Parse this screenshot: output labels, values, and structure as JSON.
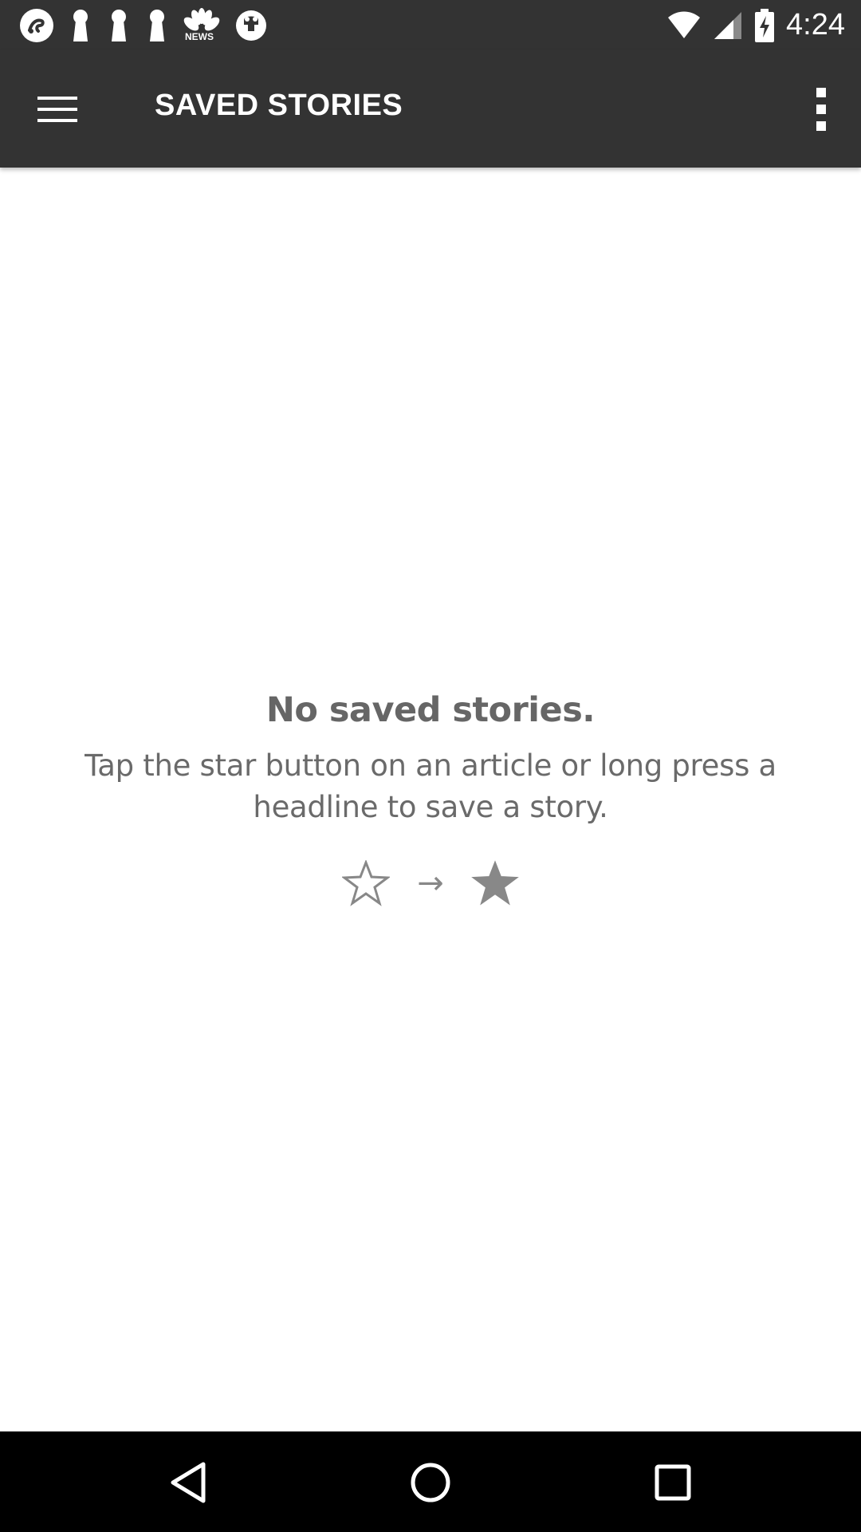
{
  "status_bar": {
    "time": "4:24",
    "notification_icons": [
      "app-logo-icon",
      "keyhole-icon",
      "keyhole-icon",
      "keyhole-icon",
      "nbc-news-icon",
      "news-app-icon"
    ],
    "nbc_label": "NEWS",
    "system_icons": [
      "wifi-icon",
      "cell-signal-icon",
      "battery-charging-icon"
    ]
  },
  "toolbar": {
    "title": "SAVED STORIES",
    "menu_icon": "hamburger-menu-icon",
    "overflow_icon": "more-vert-icon"
  },
  "empty_state": {
    "title": "No saved stories.",
    "description": "Tap the star button on an article or long press a headline to save a story.",
    "arrow": "→"
  },
  "nav_bar": {
    "buttons": [
      "back-icon",
      "home-icon",
      "recents-icon"
    ]
  },
  "colors": {
    "toolbar_bg": "#333333",
    "nav_bg": "#000000",
    "text_gray": "#666666",
    "star_gray": "#888888"
  }
}
